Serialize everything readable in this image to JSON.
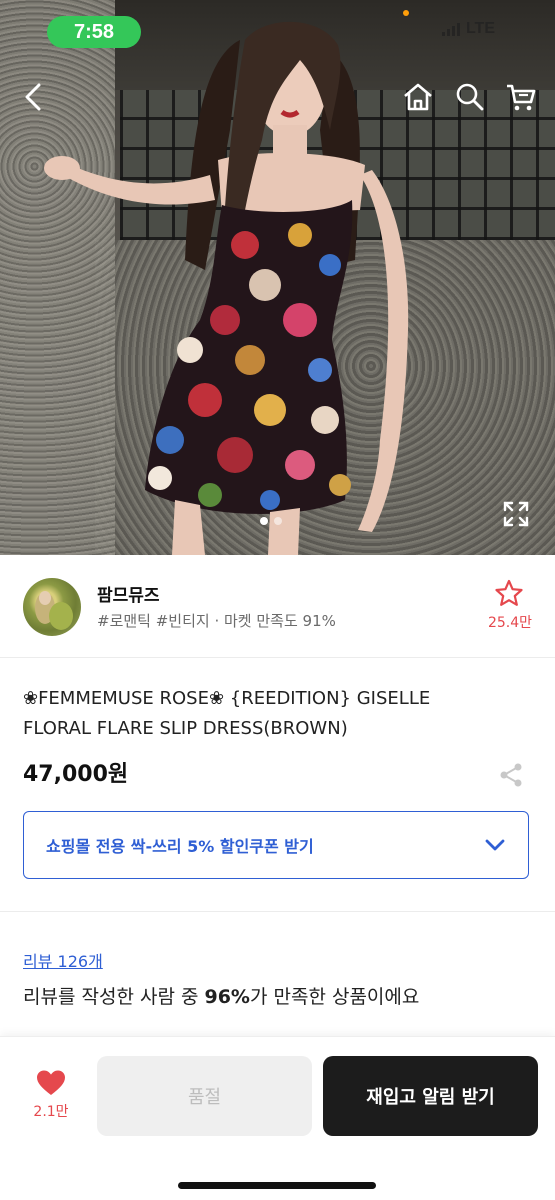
{
  "status_bar": {
    "time": "7:58",
    "network": "LTE"
  },
  "header": {
    "back_icon": "chevron-left-icon",
    "home_icon": "home-icon",
    "search_icon": "search-icon",
    "cart_icon": "cart-icon",
    "expand_icon": "expand-icon"
  },
  "gallery": {
    "slide_count": 2,
    "active_index": 0
  },
  "seller": {
    "name": "팜므뮤즈",
    "tags": "#로맨틱 #빈티지 · 마켓 만족도 91%",
    "favorite_count": "25.4만",
    "favorite_color": "#e5484d"
  },
  "product": {
    "title": "❀FEMMEMUSE ROSE❀ {REEDITION} GISELLE FLORAL FLARE SLIP DRESS(BROWN)",
    "price": "47,000원",
    "coupon_label": "쇼핑몰 전용 싹-쓰리 5% 할인쿠폰 받기",
    "accent_color": "#2f5fd4"
  },
  "review": {
    "link_label": "리뷰 126개",
    "summary_prefix": "리뷰를 작성한 사람 중 ",
    "summary_percent": "96%",
    "summary_suffix": "가 만족한 상품이에요"
  },
  "bottom_bar": {
    "like_count": "2.1만",
    "soldout_label": "품절",
    "restock_label": "재입고 알림 받기"
  }
}
